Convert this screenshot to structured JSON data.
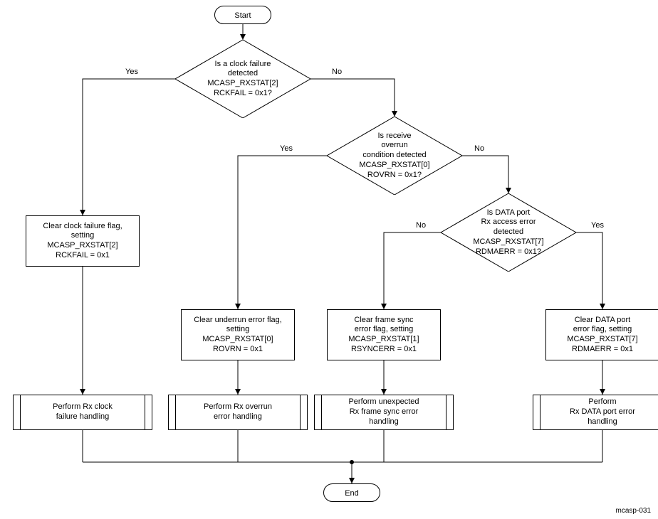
{
  "start": "Start",
  "end": "End",
  "yes": "Yes",
  "no": "No",
  "dec1_l1": "Is a clock failure",
  "dec1_l2": "detected",
  "dec1_l3": "MCASP_RXSTAT[2]",
  "dec1_l4": "RCKFAIL = 0x1?",
  "dec2_l1": "Is receive",
  "dec2_l2": "overrun",
  "dec2_l3": "condition detected",
  "dec2_l4": "MCASP_RXSTAT[0]",
  "dec2_l5": "ROVRN = 0x1?",
  "dec3_l1": "Is DATA port",
  "dec3_l2": "Rx access error",
  "dec3_l3": "detected",
  "dec3_l4": "MCASP_RXSTAT[7]",
  "dec3_l5": "RDMAERR = 0x1?",
  "procA_l1": "Clear clock failure flag,",
  "procA_l2": "setting",
  "procA_l3": "MCASP_RXSTAT[2]",
  "procA_l4": "RCKFAIL = 0x1",
  "proc1_l1": "Clear underrun error flag,",
  "proc1_l2": "setting",
  "proc1_l3": "MCASP_RXSTAT[0]",
  "proc1_l4": "ROVRN = 0x1",
  "proc2_l1": "Clear frame sync",
  "proc2_l2": "error flag, setting",
  "proc2_l3": "MCASP_RXSTAT[1]",
  "proc2_l4": "RSYNCERR = 0x1",
  "proc3_l1": "Clear DATA port",
  "proc3_l2": "error flag, setting",
  "proc3_l3": "MCASP_RXSTAT[7]",
  "proc3_l4": "RDMAERR = 0x1",
  "subA_l1": "Perform Rx clock",
  "subA_l2": "failure handling",
  "sub1_l1": "Perform Rx overrun",
  "sub1_l2": "error handling",
  "sub2_l1": "Perform unexpected",
  "sub2_l2": "Rx frame sync error",
  "sub2_l3": "handling",
  "sub3_l1": "Perform",
  "sub3_l2": "Rx DATA port error",
  "sub3_l3": "handling",
  "footer": "mcasp-031"
}
